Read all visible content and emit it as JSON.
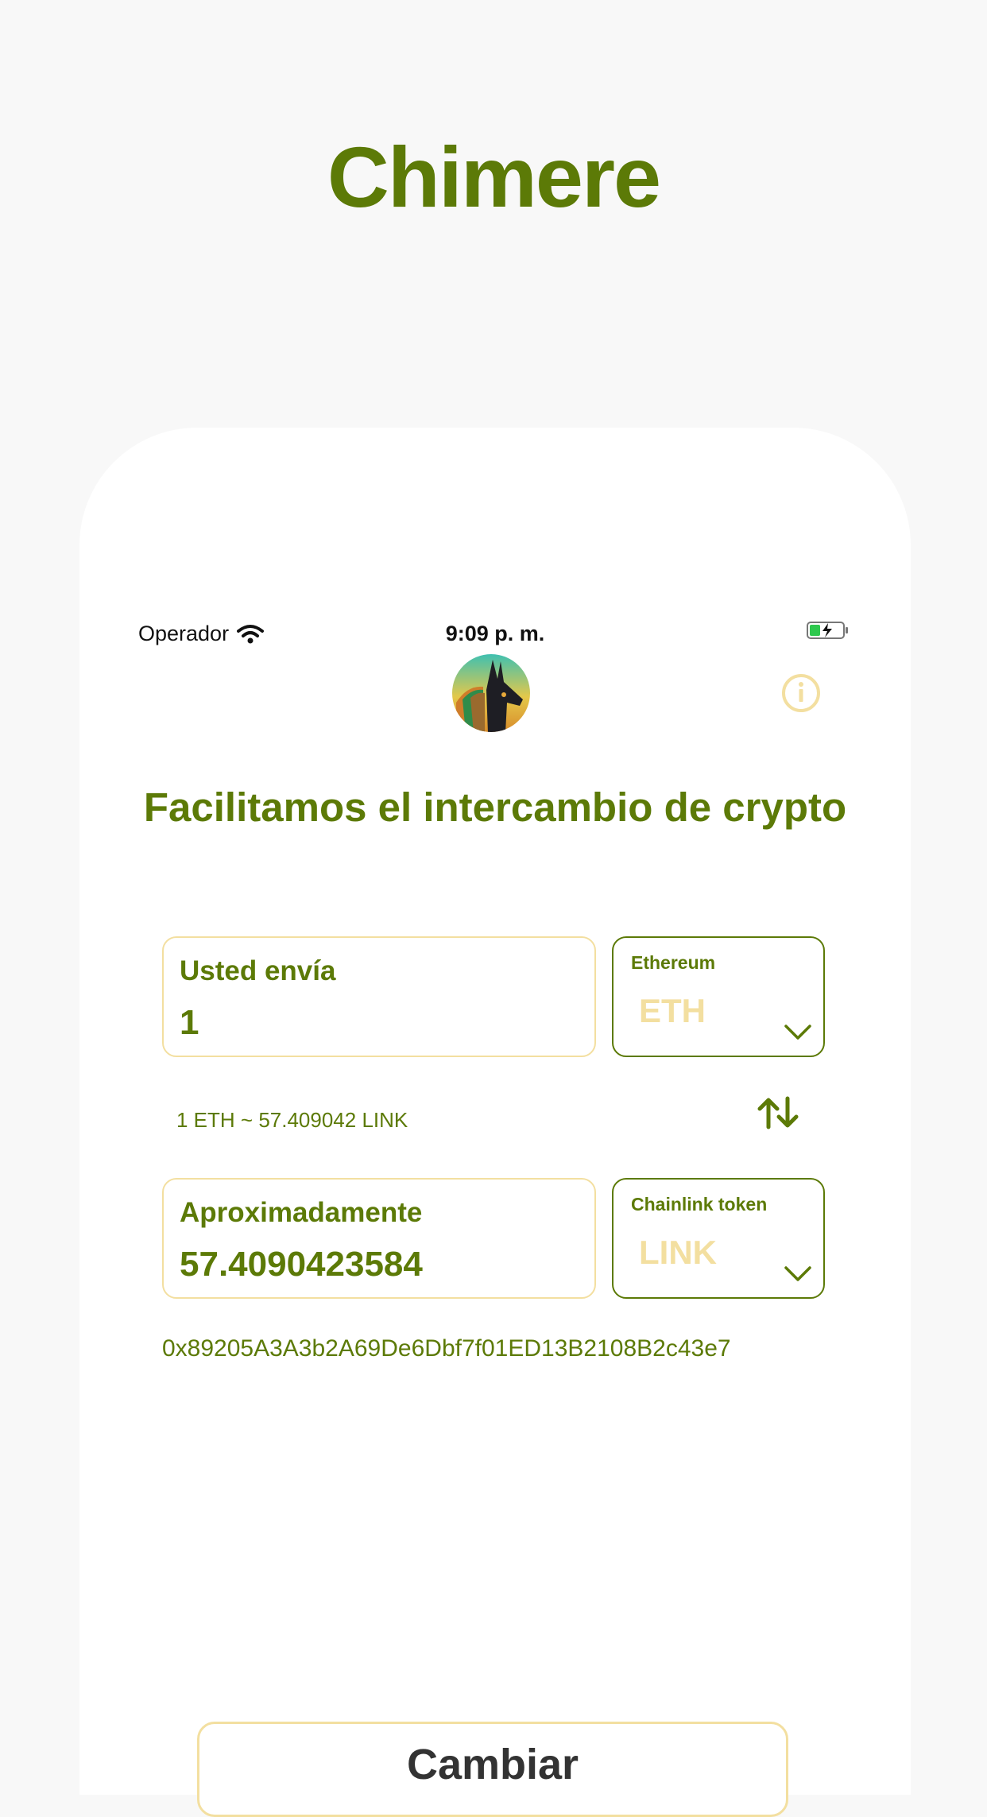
{
  "app_title": "Chimere",
  "status_bar": {
    "carrier": "Operador",
    "time": "9:09 p. m.",
    "wifi_icon": "wifi-icon",
    "battery_icon": "battery-charging-icon"
  },
  "header": {
    "logo_icon": "anubis-logo-icon",
    "info_icon": "info-icon"
  },
  "headline": "Facilitamos el intercambio de crypto",
  "send": {
    "label": "Usted envía",
    "value": "1",
    "token_name": "Ethereum",
    "token_symbol": "ETH"
  },
  "rate": "1 ETH ~ 57.409042 LINK",
  "receive": {
    "label": "Aproximadamente",
    "value": "57.4090423584",
    "token_name": "Chainlink token",
    "token_symbol": "LINK"
  },
  "address": "0x89205A3A3b2A69De6Dbf7f01ED13B2108B2c43e7",
  "action_button": "Cambiar",
  "colors": {
    "primary": "#5c7a07",
    "accent": "#f3dfa0",
    "background": "#f8f8f8",
    "card": "#ffffff"
  }
}
